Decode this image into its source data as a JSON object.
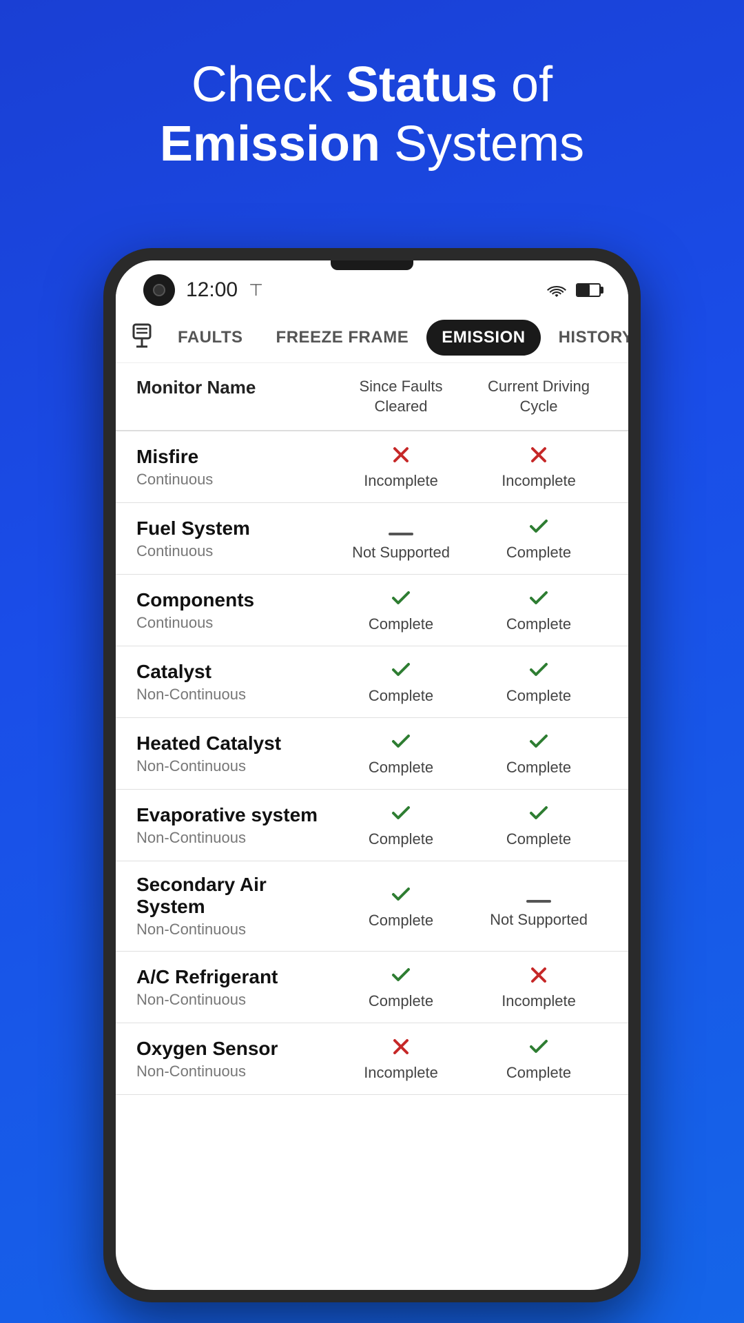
{
  "page": {
    "background": "#1a4de8",
    "header": {
      "line1_normal": "Check ",
      "line1_bold": "Status",
      "line1_normal2": " of",
      "line2_bold": "Emission",
      "line2_normal": " Systems"
    },
    "status_bar": {
      "time": "12:00",
      "wifi": "wifi",
      "battery": "battery"
    },
    "nav": {
      "icon": "⊟",
      "tabs": [
        {
          "id": "faults",
          "label": "Faults",
          "active": false
        },
        {
          "id": "freeze-frame",
          "label": "Freeze Frame",
          "active": false
        },
        {
          "id": "emission",
          "label": "Emission",
          "active": true
        },
        {
          "id": "history",
          "label": "History",
          "active": false
        }
      ]
    },
    "table": {
      "headers": {
        "monitor_name": "Monitor Name",
        "since_faults": "Since Faults Cleared",
        "current_cycle": "Current Driving Cycle"
      },
      "rows": [
        {
          "name": "Misfire",
          "type": "Continuous",
          "since_status": "incomplete",
          "since_label": "Incomplete",
          "current_status": "incomplete",
          "current_label": "Incomplete"
        },
        {
          "name": "Fuel System",
          "type": "Continuous",
          "since_status": "not-supported",
          "since_label": "Not Supported",
          "current_status": "complete",
          "current_label": "Complete"
        },
        {
          "name": "Components",
          "type": "Continuous",
          "since_status": "complete",
          "since_label": "Complete",
          "current_status": "complete",
          "current_label": "Complete"
        },
        {
          "name": "Catalyst",
          "type": "Non-Continuous",
          "since_status": "complete",
          "since_label": "Complete",
          "current_status": "complete",
          "current_label": "Complete"
        },
        {
          "name": "Heated Catalyst",
          "type": "Non-Continuous",
          "since_status": "complete",
          "since_label": "Complete",
          "current_status": "complete",
          "current_label": "Complete"
        },
        {
          "name": "Evaporative system",
          "type": "Non-Continuous",
          "since_status": "complete",
          "since_label": "Complete",
          "current_status": "complete",
          "current_label": "Complete"
        },
        {
          "name": "Secondary Air System",
          "type": "Non-Continuous",
          "since_status": "complete",
          "since_label": "Complete",
          "current_status": "not-supported",
          "current_label": "Not Supported"
        },
        {
          "name": "A/C Refrigerant",
          "type": "Non-Continuous",
          "since_status": "complete",
          "since_label": "Complete",
          "current_status": "incomplete",
          "current_label": "Incomplete"
        },
        {
          "name": "Oxygen Sensor",
          "type": "Non-Continuous",
          "since_status": "incomplete",
          "since_label": "Incomplete",
          "current_status": "complete",
          "current_label": "Complete"
        }
      ]
    }
  }
}
